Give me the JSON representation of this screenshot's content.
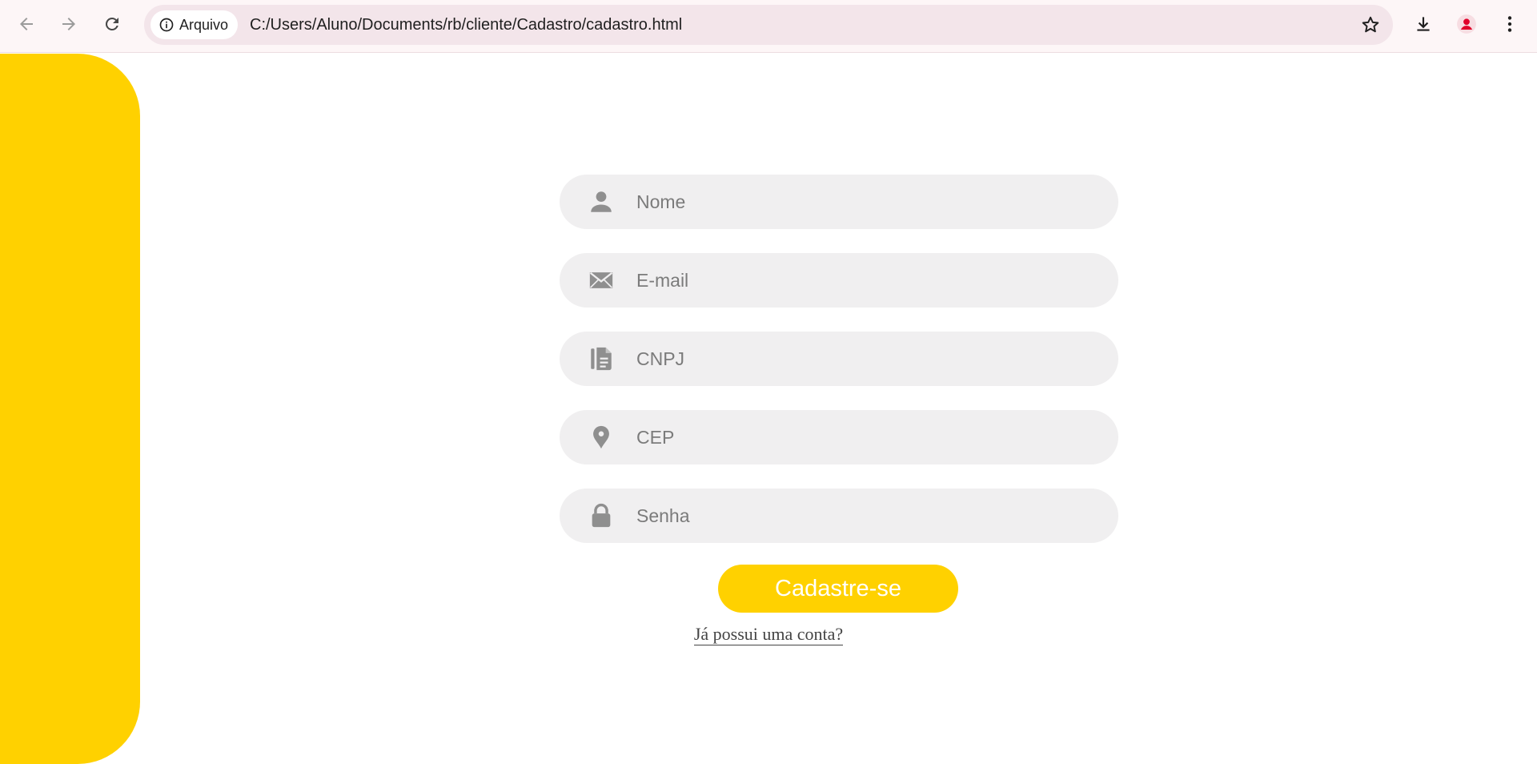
{
  "browser": {
    "site_chip_label": "Arquivo",
    "url": "C:/Users/Aluno/Documents/rb/cliente/Cadastro/cadastro.html",
    "icons": [
      "back-arrow-icon",
      "forward-arrow-icon",
      "reload-icon",
      "info-icon",
      "star-icon",
      "download-icon",
      "profile-icon",
      "more-vert-icon"
    ],
    "profile_color": "#e0002a"
  },
  "page": {
    "accent_color": "#ffd100",
    "fields": [
      {
        "placeholder": "Nome",
        "icon": "person-icon"
      },
      {
        "placeholder": "E-mail",
        "icon": "envelope-icon"
      },
      {
        "placeholder": "CNPJ",
        "icon": "document-icon"
      },
      {
        "placeholder": "CEP",
        "icon": "location-pin-icon"
      },
      {
        "placeholder": "Senha",
        "icon": "lock-icon"
      }
    ],
    "submit_label": "Cadastre-se",
    "login_link_label": "Já possui uma conta?"
  }
}
